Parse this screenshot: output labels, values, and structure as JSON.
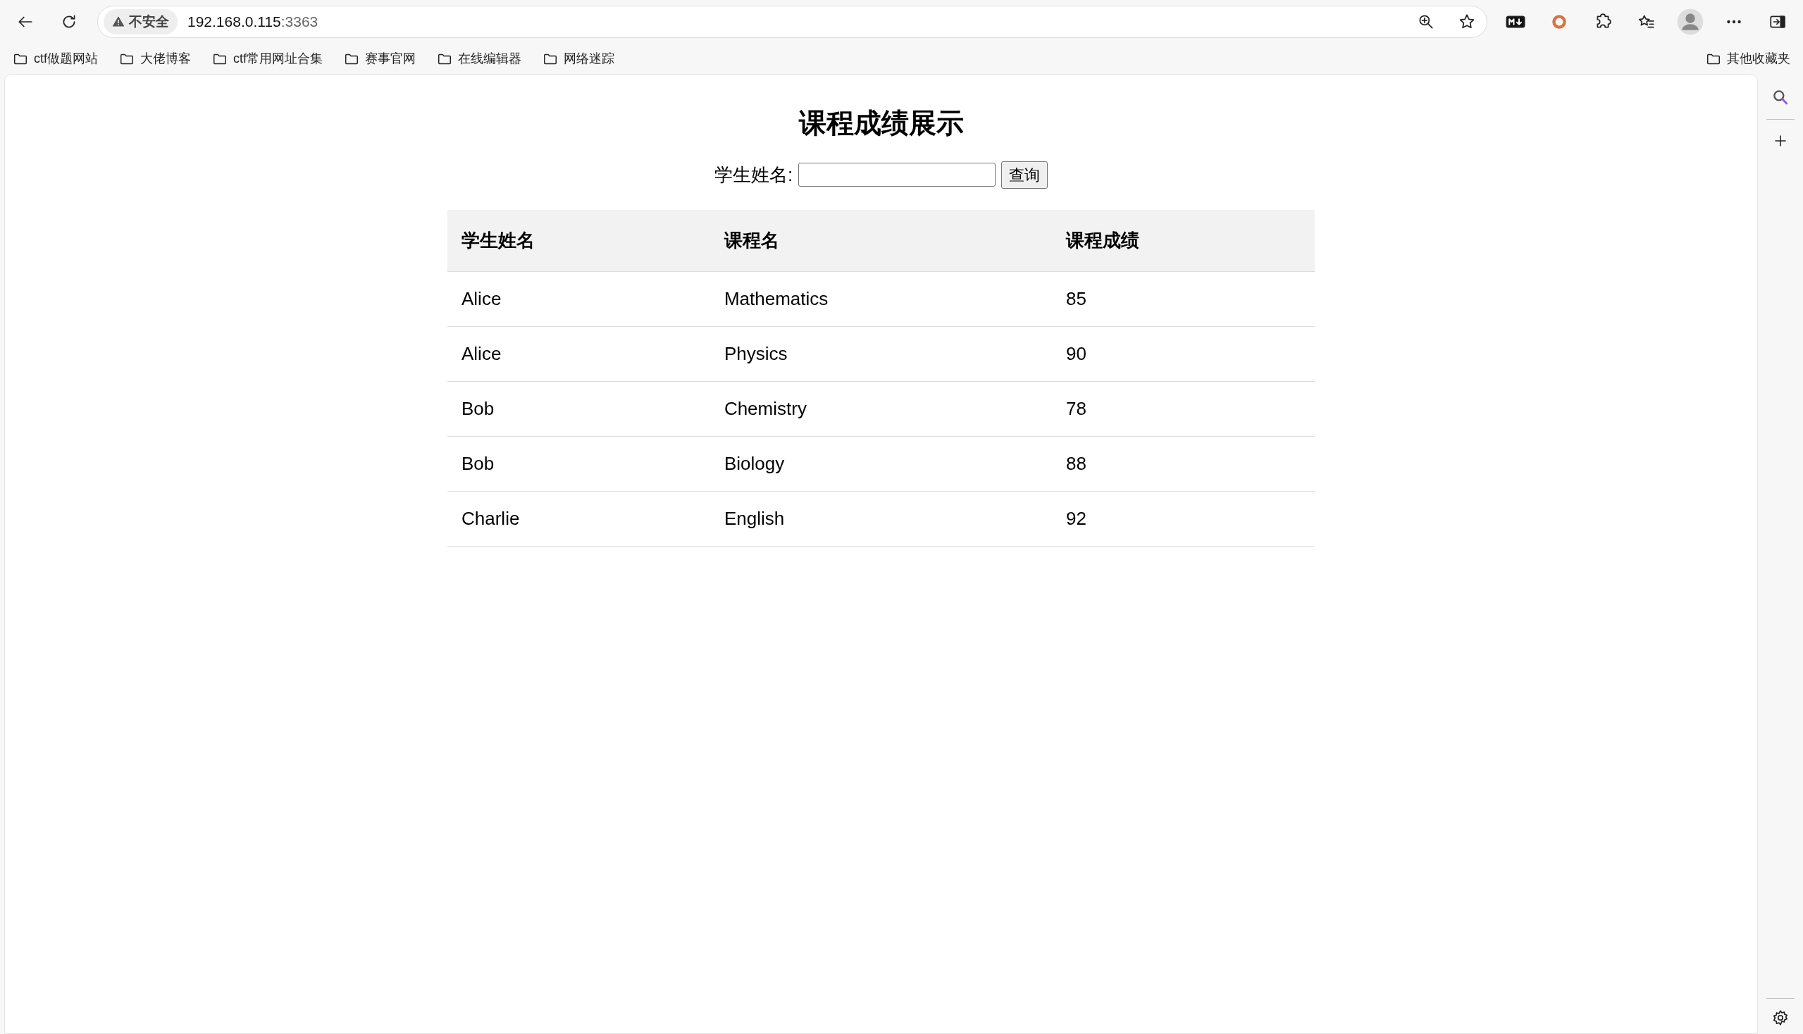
{
  "browser": {
    "security_label": "不安全",
    "url_host": "192.168.0.115",
    "url_port": ":3363",
    "bookmarks": [
      "ctf做题网站",
      "大佬博客",
      "ctf常用网址合集",
      "赛事官网",
      "在线编辑器",
      "网络迷踪"
    ],
    "other_bookmarks": "其他收藏夹"
  },
  "page": {
    "title": "课程成绩展示",
    "search_label": "学生姓名:",
    "search_button": "查询",
    "table": {
      "columns": [
        "学生姓名",
        "课程名",
        "课程成绩"
      ],
      "rows": [
        [
          "Alice",
          "Mathematics",
          "85"
        ],
        [
          "Alice",
          "Physics",
          "90"
        ],
        [
          "Bob",
          "Chemistry",
          "78"
        ],
        [
          "Bob",
          "Biology",
          "88"
        ],
        [
          "Charlie",
          "English",
          "92"
        ]
      ]
    }
  }
}
